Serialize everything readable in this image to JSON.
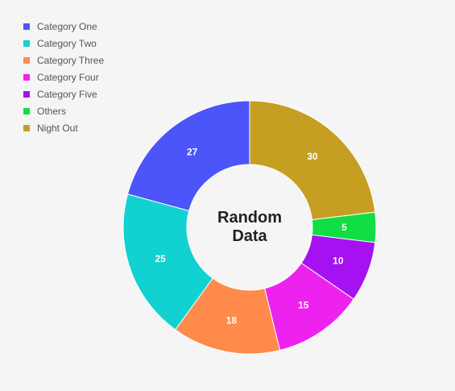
{
  "chart_data": {
    "type": "pie",
    "variant": "donut",
    "title_lines": [
      "Random",
      "Data"
    ],
    "categories": [
      "Night Out",
      "Others",
      "Category Five",
      "Category Four",
      "Category Three",
      "Category Two",
      "Category One"
    ],
    "values": [
      30,
      5,
      10,
      15,
      18,
      25,
      27
    ],
    "colors": [
      "#c59e22",
      "#11dd44",
      "#a511f0",
      "#ee22ee",
      "#ff8a4c",
      "#11d1d1",
      "#4b55f9"
    ],
    "labels": [
      "30",
      "5",
      "10",
      "15",
      "18",
      "25",
      "27"
    ],
    "legend_position": "top-left",
    "legend": [
      {
        "label": "Category One",
        "color": "#4b55f9"
      },
      {
        "label": "Category Two",
        "color": "#11d1d1"
      },
      {
        "label": "Category Three",
        "color": "#ff8a4c"
      },
      {
        "label": "Category Four",
        "color": "#ee22ee"
      },
      {
        "label": "Category Five",
        "color": "#a511f0"
      },
      {
        "label": "Others",
        "color": "#11dd44"
      },
      {
        "label": "Night Out",
        "color": "#c59e22"
      }
    ]
  }
}
